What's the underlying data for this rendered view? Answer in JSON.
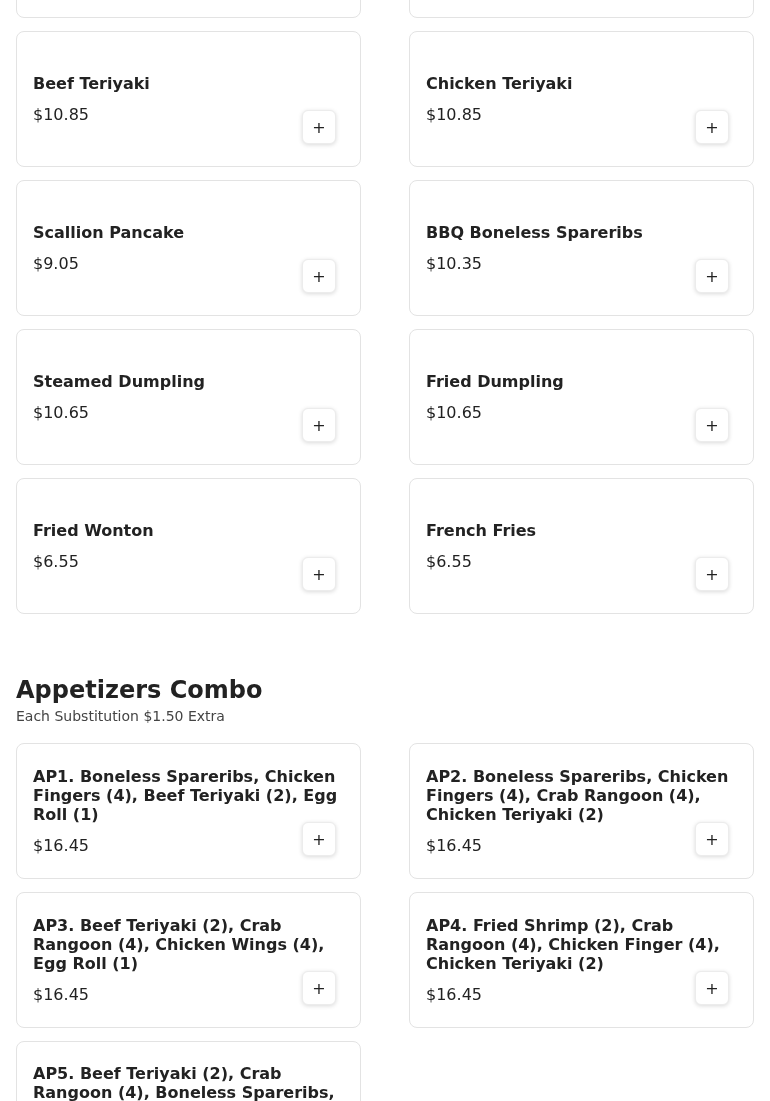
{
  "sections": [
    {
      "items": [
        {
          "kind": "cut"
        },
        {
          "kind": "cut"
        },
        {
          "kind": "item",
          "name": "Beef Teriyaki",
          "price": "$10.85",
          "button": "+"
        },
        {
          "kind": "item",
          "name": "Chicken Teriyaki",
          "price": "$10.85",
          "button": "+"
        },
        {
          "kind": "item",
          "name": "Scallion Pancake",
          "price": "$9.05",
          "button": "+"
        },
        {
          "kind": "item",
          "name": "BBQ Boneless Spareribs",
          "price": "$10.35",
          "button": "+"
        },
        {
          "kind": "item",
          "name": "Steamed Dumpling",
          "price": "$10.65",
          "button": "+"
        },
        {
          "kind": "item",
          "name": "Fried Dumpling",
          "price": "$10.65",
          "button": "+"
        },
        {
          "kind": "item",
          "name": "Fried Wonton",
          "price": "$6.55",
          "button": "+"
        },
        {
          "kind": "item",
          "name": "French Fries",
          "price": "$6.55",
          "button": "+"
        }
      ]
    },
    {
      "title": "Appetizers Combo",
      "subtitle": "Each Substitution $1.50 Extra",
      "items": [
        {
          "kind": "item",
          "name": "AP1. Boneless Spareribs, Chicken Fingers (4), Beef Teriyaki (2), Egg Roll (1)",
          "price": "$16.45",
          "button": "+"
        },
        {
          "kind": "item",
          "name": "AP2. Boneless Spareribs, Chicken Fingers (4), Crab Rangoon (4), Chicken Teriyaki (2)",
          "price": "$16.45",
          "button": "+"
        },
        {
          "kind": "item",
          "name": "AP3. Beef Teriyaki (2), Crab Rangoon (4), Chicken Wings (4), Egg Roll (1)",
          "price": "$16.45",
          "button": "+"
        },
        {
          "kind": "item",
          "name": "AP4. Fried Shrimp (2), Crab Rangoon (4), Chicken Finger (4), Chicken Teriyaki (2)",
          "price": "$16.45",
          "button": "+"
        },
        {
          "kind": "item",
          "name": "AP5. Beef Teriyaki (2), Crab Rangoon (4), Boneless Spareribs,"
        }
      ]
    }
  ]
}
